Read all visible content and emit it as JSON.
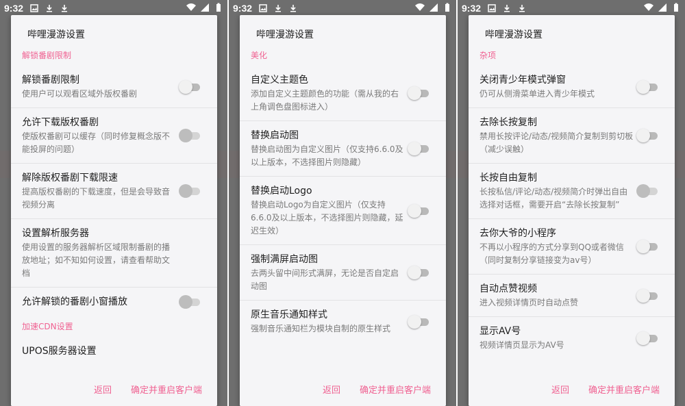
{
  "status_bar": {
    "time": "9:32"
  },
  "dialog_title": "哔哩漫游设置",
  "actions": {
    "back": "返回",
    "confirm": "确定并重启客户端"
  },
  "screens": [
    {
      "sections": [
        {
          "header": "解锁番剧限制",
          "items": [
            {
              "title": "解锁番剧限制",
              "subtitle": "使用户可以观看区域外版权番剧",
              "toggle": "off"
            },
            {
              "title": "允许下载版权番剧",
              "subtitle": "使版权番剧可以缓存（同时修复概念版不能投屏的问题）",
              "toggle": "disabled"
            },
            {
              "title": "解除版权番剧下载限速",
              "subtitle": "提高版权番剧的下载速度，但是会导致音视频分离",
              "toggle": "disabled"
            },
            {
              "title": "设置解析服务器",
              "subtitle": "使用设置的服务器解析区域限制番剧的播放地址；如不知如何设置，请查看帮助文档",
              "toggle": "none"
            },
            {
              "title": "允许解锁的番剧小窗播放",
              "subtitle": "",
              "toggle": "disabled"
            }
          ]
        },
        {
          "header": "加速CDN设置",
          "items": [
            {
              "title": "UPOS服务器设置",
              "subtitle": "",
              "toggle": "none"
            }
          ]
        }
      ]
    },
    {
      "sections": [
        {
          "header": "美化",
          "items": [
            {
              "title": "自定义主题色",
              "subtitle": "添加自定义主题颜色的功能（需从我的右上角调色盘图标进入）",
              "toggle": "off"
            },
            {
              "title": "替换启动图",
              "subtitle": "替换启动图为自定义图片（仅支持6.6.0及以上版本，不选择图片则隐藏）",
              "toggle": "off"
            },
            {
              "title": "替换启动Logo",
              "subtitle": "替换启动Logo为自定义图片（仅支持6.6.0及以上版本，不选择图片则隐藏，延迟生效）",
              "toggle": "off"
            },
            {
              "title": "强制满屏启动图",
              "subtitle": "去两头留中间形式满屏，无论是否自定启动图",
              "toggle": "off"
            },
            {
              "title": "原生音乐通知样式",
              "subtitle": "强制音乐通知栏为模块自制的原生样式",
              "toggle": "off"
            }
          ]
        }
      ]
    },
    {
      "sections": [
        {
          "header": "杂项",
          "items": [
            {
              "title": "关闭青少年模式弹窗",
              "subtitle": "仍可从侧滑菜单进入青少年模式",
              "toggle": "off"
            },
            {
              "title": "去除长按复制",
              "subtitle": "禁用长按评论/动态/视频简介复制到剪切板（减少误触）",
              "toggle": "off"
            },
            {
              "title": "长按自由复制",
              "subtitle": "长按私信/评论/动态/视频简介时弹出自由选择对话框，需要开启“去除长按复制”",
              "toggle": "disabled"
            },
            {
              "title": "去你大爷的小程序",
              "subtitle": "不再以小程序的方式分享到QQ或者微信（同时复制分享链接变为av号）",
              "toggle": "off"
            },
            {
              "title": "自动点赞视频",
              "subtitle": "进入视频详情页时自动点赞",
              "toggle": "off"
            },
            {
              "title": "显示AV号",
              "subtitle": "视频详情页显示为AV号",
              "toggle": "off"
            }
          ]
        }
      ]
    }
  ]
}
